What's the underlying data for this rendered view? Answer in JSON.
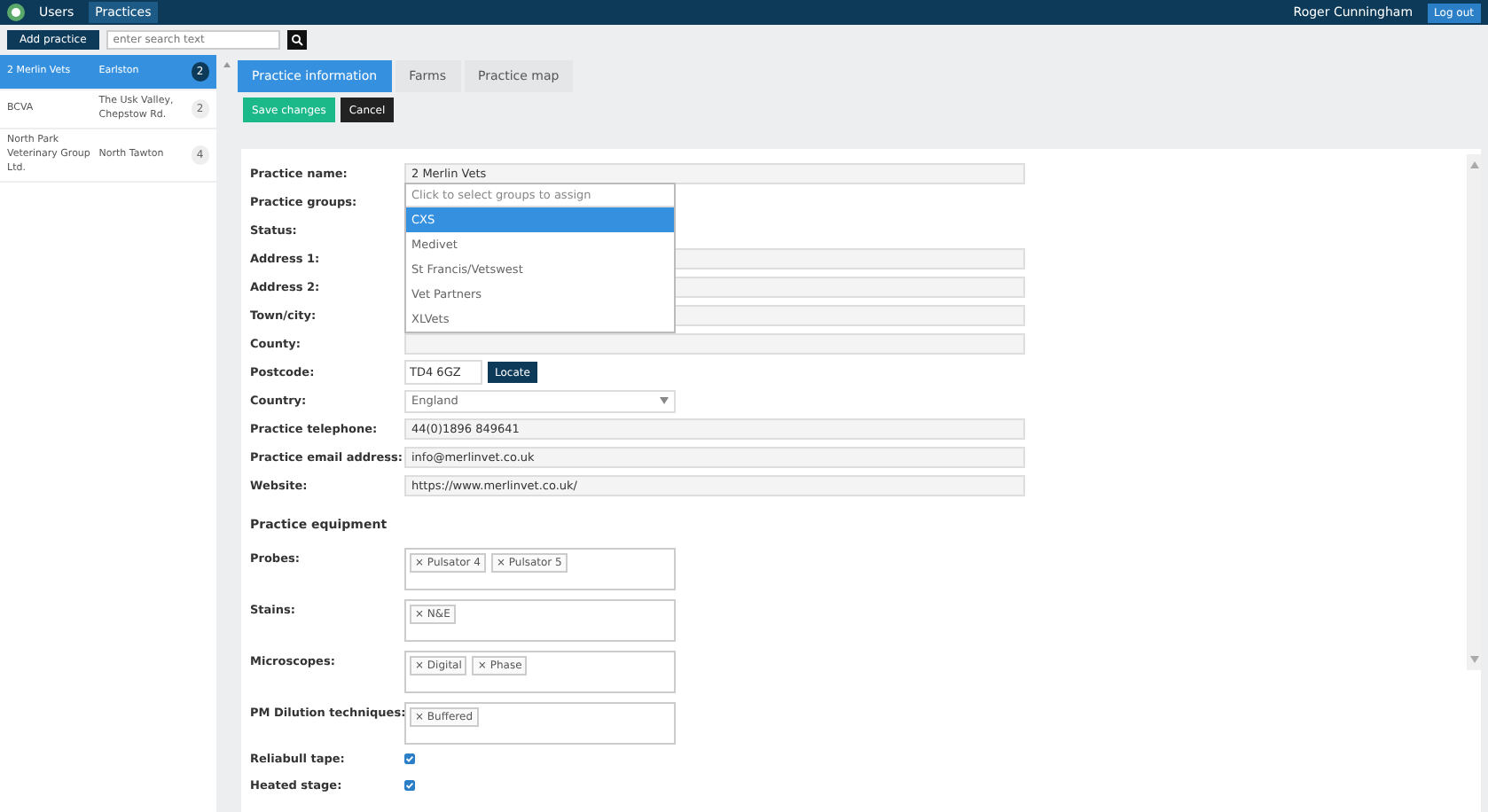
{
  "nav": {
    "tabs": [
      {
        "label": "Users",
        "selected": false
      },
      {
        "label": "Practices",
        "selected": true
      }
    ],
    "user": "Roger Cunningham",
    "logout": "Log out"
  },
  "toolbar": {
    "add_button": "Add practice",
    "search": {
      "placeholder": "enter search text"
    }
  },
  "practices": [
    {
      "name": "2 Merlin Vets",
      "town": "Earlston",
      "count": "2",
      "selected": true
    },
    {
      "name": "BCVA",
      "town": "The Usk Valley, Chepstow Rd.",
      "count": "2",
      "selected": false
    },
    {
      "name": "North Park Veterinary Group Ltd.",
      "town": "North Tawton",
      "count": "4",
      "selected": false
    }
  ],
  "tabs": [
    {
      "label": "Practice information",
      "selected": true
    },
    {
      "label": "Farms",
      "selected": false
    },
    {
      "label": "Practice map",
      "selected": false
    }
  ],
  "actions": {
    "save": "Save changes",
    "cancel": "Cancel"
  },
  "form": [
    {
      "kind": "text",
      "label": "Practice name:",
      "value": "2 Merlin Vets"
    },
    {
      "kind": "groups",
      "label": "Practice groups:",
      "placeholder": "Click to select groups to assign",
      "options": [
        {
          "label": "CXS",
          "selected": true
        },
        {
          "label": "Medivet",
          "selected": false
        },
        {
          "label": "St Francis/Vetswest",
          "selected": false
        },
        {
          "label": "Vet Partners",
          "selected": false
        },
        {
          "label": "XLVets",
          "selected": false
        }
      ]
    },
    {
      "kind": "hidden",
      "label": "Status:"
    },
    {
      "kind": "text",
      "label": "Address 1:"
    },
    {
      "kind": "text",
      "label": "Address 2:"
    },
    {
      "kind": "text",
      "label": "Town/city:"
    },
    {
      "kind": "text",
      "label": "County:"
    },
    {
      "kind": "postcode",
      "label": "Postcode:",
      "value": "TD4 6GZ",
      "button": "Locate"
    },
    {
      "kind": "select",
      "label": "Country:",
      "value": "England"
    },
    {
      "kind": "text",
      "label": "Practice telephone:",
      "value": "44(0)1896 849641"
    },
    {
      "kind": "text",
      "label": "Practice email address:",
      "value": "info@merlinvet.co.uk"
    },
    {
      "kind": "text",
      "label": "Website:",
      "value": "https://www.merlinvet.co.uk/"
    }
  ],
  "equipment": {
    "heading": "Practice equipment",
    "rows": [
      {
        "kind": "tags",
        "label": "Probes:",
        "tags": [
          "× Pulsator 4",
          "× Pulsator 5"
        ]
      },
      {
        "kind": "tags",
        "label": "Stains:",
        "tags": [
          "× N&E"
        ]
      },
      {
        "kind": "tags",
        "label": "Microscopes:",
        "tags": [
          "× Digital",
          "× Phase"
        ]
      },
      {
        "kind": "tags",
        "label": "PM Dilution techniques:",
        "tags": [
          "× Buffered"
        ]
      },
      {
        "kind": "checkbox",
        "label": "Reliabull tape:",
        "checked": true
      },
      {
        "kind": "checkbox",
        "label": "Heated stage:",
        "checked": true
      }
    ]
  }
}
